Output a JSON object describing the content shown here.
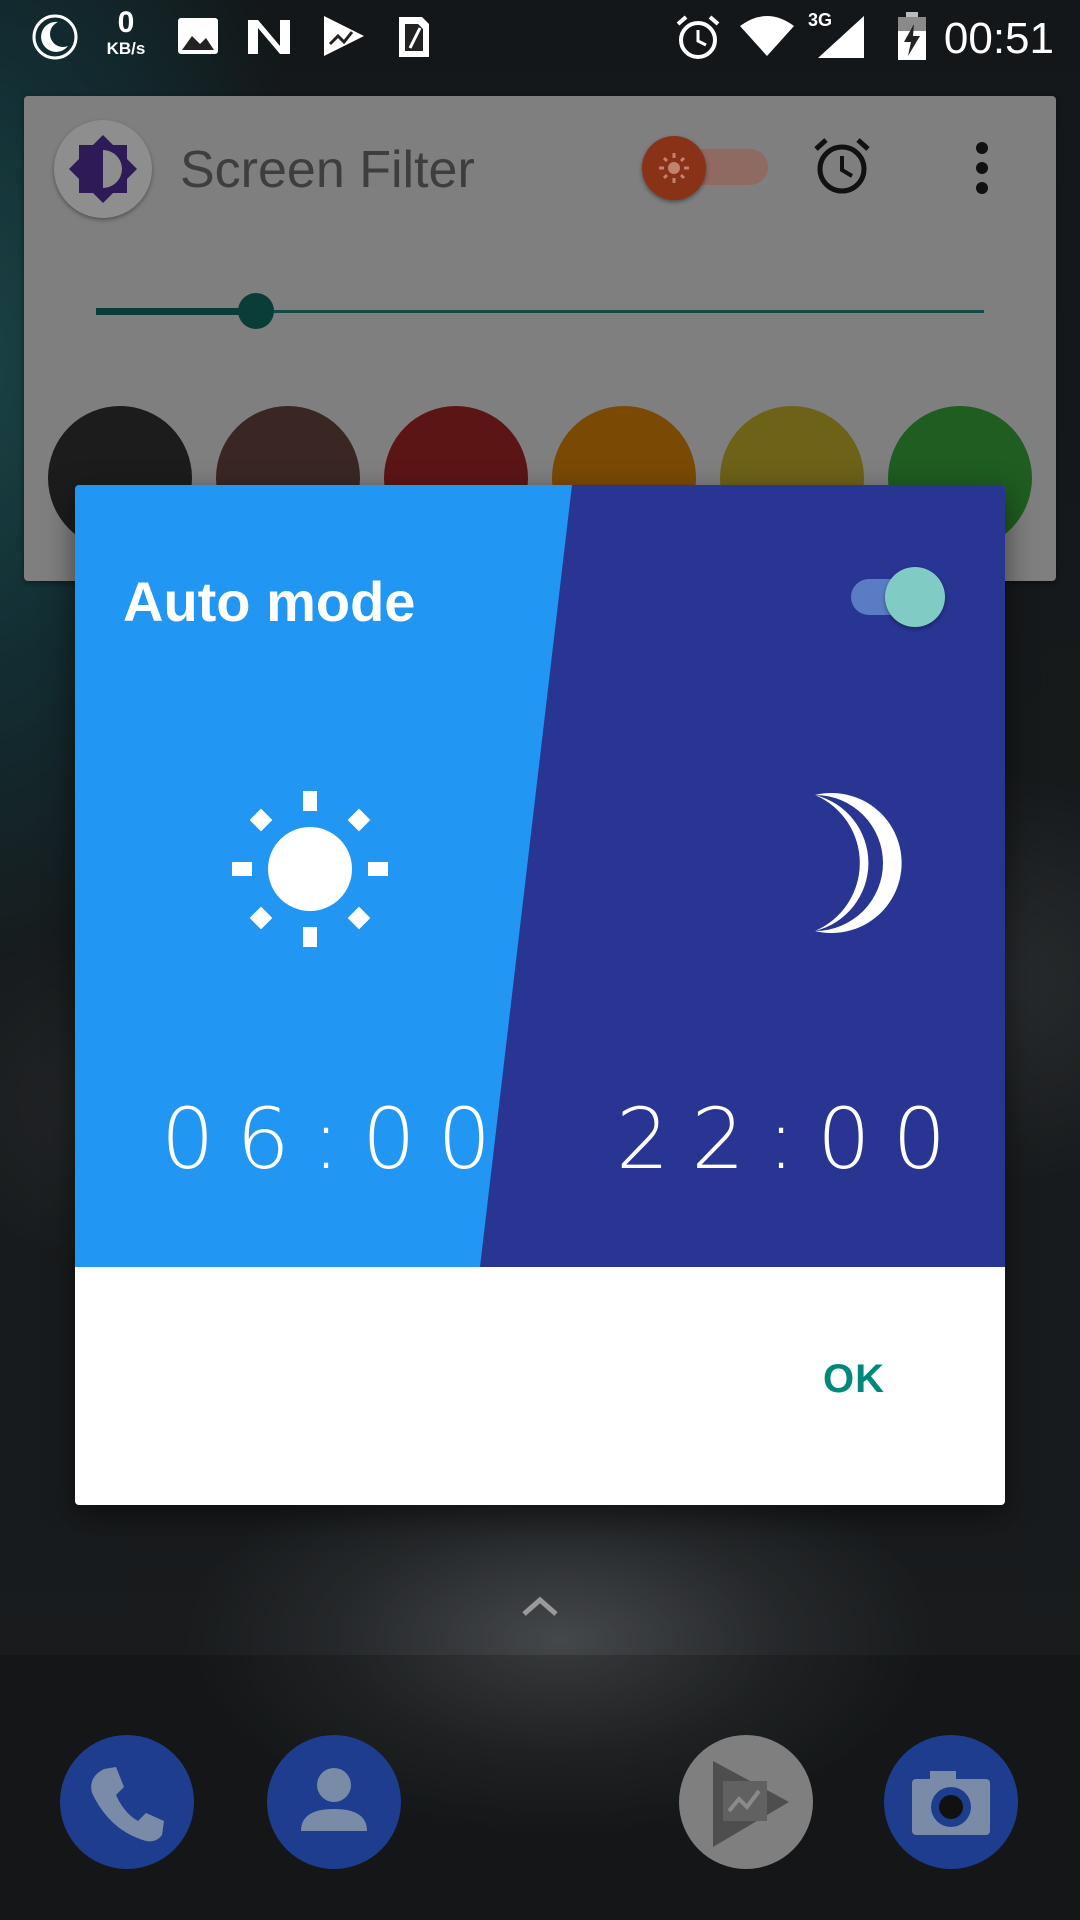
{
  "status_bar": {
    "netspeed_value": "0",
    "netspeed_unit": "KB/s",
    "network_type": "3G",
    "time": "00:51",
    "left_icons": [
      "moon-icon",
      "image-icon",
      "n-icon",
      "play-store-icon",
      "sim-card-icon"
    ],
    "right_icons": [
      "alarm-icon",
      "wifi-icon",
      "signal-icon",
      "battery-charging-icon"
    ]
  },
  "app_card": {
    "title": "Screen Filter",
    "icons": [
      "brightness-icon",
      "alarm-icon",
      "more-vert-icon"
    ],
    "filter_enabled": true,
    "intensity_fraction": 0.18,
    "swatches": [
      "#1c1c1c",
      "#3a2724",
      "#5c1515",
      "#7a4a05",
      "#6e6118",
      "#1f5d21"
    ]
  },
  "dialog": {
    "title": "Auto mode",
    "auto_mode_enabled": true,
    "day_time": "06:00",
    "night_time": "22:00",
    "ok_label": "OK",
    "colors": {
      "day_panel": "#2196f3",
      "night_panel": "#283593",
      "toggle_thumb": "#80cbc4",
      "ok_text": "#00897b"
    },
    "icons": [
      "sun-icon",
      "moon-icon"
    ]
  },
  "dock": {
    "apps": [
      {
        "name": "phone",
        "icon": "phone-icon",
        "color": "#1e3d8f"
      },
      {
        "name": "contacts",
        "icon": "person-icon",
        "color": "#1e3d8f"
      },
      {
        "name": "play-movies",
        "icon": "play-movies-icon",
        "color": "#7f7f7f"
      },
      {
        "name": "camera",
        "icon": "camera-icon",
        "color": "#1e3d8f"
      }
    ],
    "up_arrow_icon": "chevron-up-icon"
  }
}
